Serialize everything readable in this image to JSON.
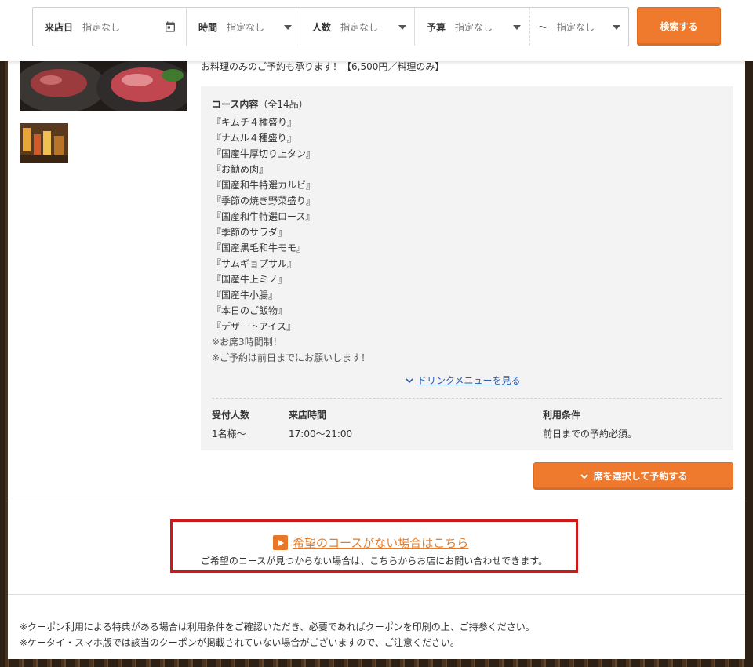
{
  "search": {
    "date_label": "来店日",
    "date_value": "指定なし",
    "time_label": "時間",
    "time_value": "指定なし",
    "people_label": "人数",
    "people_value": "指定なし",
    "budget_label": "予算",
    "budget_min": "指定なし",
    "budget_sep": "～",
    "budget_max": "指定なし",
    "button": "検索する"
  },
  "course": {
    "lead": "お料理のみのご予約も承ります！【6,500円／料理のみ】",
    "title": "コース内容",
    "count": "（全14品）",
    "items": [
      "『キムチ４種盛り』",
      "『ナムル４種盛り』",
      "『国産牛厚切り上タン』",
      "『お勧め肉』",
      "『国産和牛特選カルビ』",
      "『季節の焼き野菜盛り』",
      "『国産和牛特選ロース』",
      "『季節のサラダ』",
      "『国産黒毛和牛モモ』",
      "『サムギョプサル』",
      "『国産牛上ミノ』",
      "『国産牛小腸』",
      "『本日のご飯物』",
      "『デザートアイス』"
    ],
    "notes": [
      "※お席3時間制！",
      "※ご予約は前日までにお願いします！"
    ],
    "drink_link": "ドリンクメニューを見る",
    "info": {
      "people_h": "受付人数",
      "people_v": "1名様～",
      "time_h": "来店時間",
      "time_v": "17:00～21:00",
      "cond_h": "利用条件",
      "cond_v": "前日までの予約必須。"
    },
    "reserve_button": "席を選択して予約する"
  },
  "nocourse": {
    "link": "希望のコースがない場合はこちら",
    "desc": "ご希望のコースが見つからない場合は、こちらからお店にお問い合わせできます。"
  },
  "footnotes": [
    "※クーポン利用による特典がある場合は利用条件をご確認いただき、必要であればクーポンを印刷の上、ご持参ください。",
    "※ケータイ・スマホ版では該当のクーポンが掲載されていない場合がございますので、ご注意ください。"
  ],
  "colors": {
    "accent": "#ef7a2d",
    "link": "#2a5db0",
    "highlight_border": "#d01818"
  }
}
